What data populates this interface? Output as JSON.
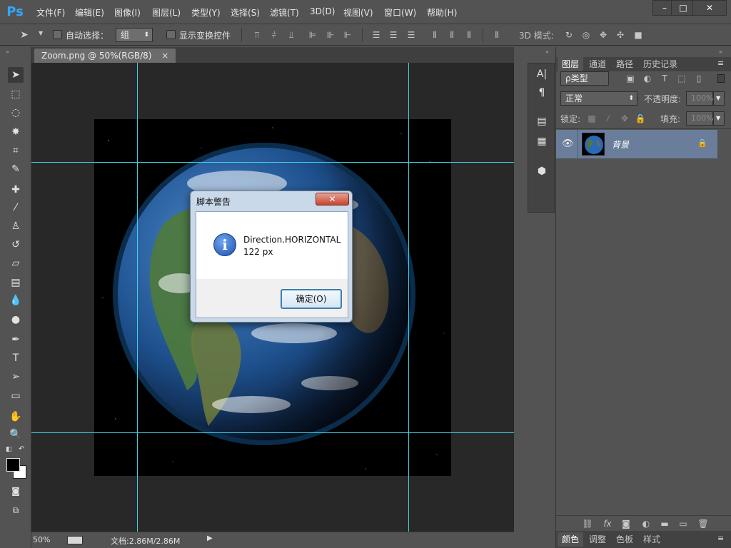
{
  "app": {
    "logo": "Ps"
  },
  "menu": [
    "文件(F)",
    "编辑(E)",
    "图像(I)",
    "图层(L)",
    "类型(Y)",
    "选择(S)",
    "滤镜(T)",
    "3D(D)",
    "视图(V)",
    "窗口(W)",
    "帮助(H)"
  ],
  "window_buttons": {
    "minimize": "–",
    "maximize": "□",
    "close": "✕"
  },
  "options": {
    "auto_select_label": "自动选择：",
    "auto_select_value": "组",
    "show_transform_label": "显示变换控件",
    "mode_3d_label": "3D 模式:"
  },
  "document": {
    "tab_title": "Zoom.png @ 50%(RGB/8)",
    "tab_close": "×",
    "zoom": "50%",
    "doc_info": "文档:2.86M/2.86M"
  },
  "dialog": {
    "title": "脚本警告",
    "close": "✕",
    "icon": "i",
    "line1": "Direction.HORIZONTAL",
    "line2": "122 px",
    "ok": "确定(O)"
  },
  "layers_panel": {
    "tabs": [
      "图层",
      "通道",
      "路径",
      "历史记录"
    ],
    "filter_kind": "ρ类型",
    "blend_mode": "正常",
    "opacity_label": "不透明度:",
    "opacity_value": "100%",
    "lock_label": "锁定:",
    "fill_label": "填充:",
    "fill_value": "100%",
    "layer_name": "背景"
  },
  "bottom_tabs": [
    "颜色",
    "调整",
    "色板",
    "样式"
  ],
  "colors": {
    "guide": "#3fd3e6",
    "ps_blue": "#31a8ff",
    "layer_selected": "#6a7d9a"
  }
}
